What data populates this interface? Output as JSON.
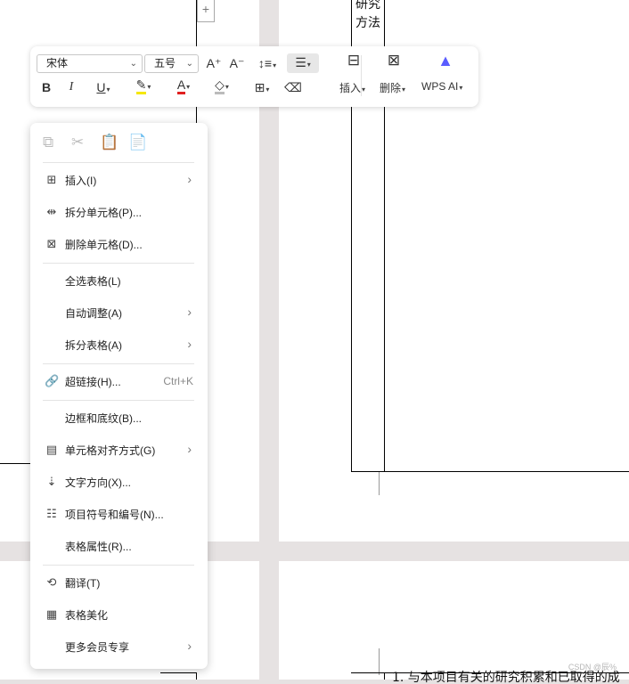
{
  "document": {
    "cell_text_line1": "研究",
    "cell_text_line2": "方法",
    "bottom_text": "1. 与本项目有关的研究积累和已取得的成",
    "add_row_symbol": "+"
  },
  "toolbar": {
    "font_name": "宋体",
    "font_size": "五号",
    "grow_font": "A⁺",
    "shrink_font": "A⁻",
    "bold": "B",
    "italic": "I",
    "underline": "U",
    "font_color_glyph": "A",
    "insert_label": "插入",
    "delete_label": "删除",
    "ai_label": "WPS AI",
    "highlight_color": "#f5e700",
    "font_color": "#e02020",
    "ai_gradient_start": "#4a5cff",
    "ai_gradient_end": "#ff4d7a"
  },
  "context_menu": {
    "clipboard_icons": [
      "copy-icon",
      "cut-icon",
      "paste-icon",
      "paste-special-icon"
    ],
    "items": [
      {
        "label": "插入(I)",
        "icon": "table-insert-icon",
        "submenu": true
      },
      {
        "label": "拆分单元格(P)...",
        "icon": "split-cells-icon"
      },
      {
        "label": "删除单元格(D)...",
        "icon": "delete-cells-icon"
      },
      {
        "label": "全选表格(L)"
      },
      {
        "label": "自动调整(A)",
        "submenu": true
      },
      {
        "label": "拆分表格(A)",
        "submenu": true
      },
      {
        "label": "超链接(H)...",
        "icon": "link-icon",
        "shortcut": "Ctrl+K"
      },
      {
        "label": "边框和底纹(B)..."
      },
      {
        "label": "单元格对齐方式(G)",
        "icon": "cell-align-icon",
        "submenu": true
      },
      {
        "label": "文字方向(X)...",
        "icon": "text-direction-icon"
      },
      {
        "label": "项目符号和编号(N)...",
        "icon": "bullets-icon"
      },
      {
        "label": "表格属性(R)..."
      },
      {
        "label": "翻译(T)",
        "icon": "translate-icon"
      },
      {
        "label": "表格美化",
        "icon": "table-beautify-icon"
      },
      {
        "label": "更多会员专享",
        "submenu": true
      }
    ]
  },
  "watermark": "CSDN @辰%"
}
